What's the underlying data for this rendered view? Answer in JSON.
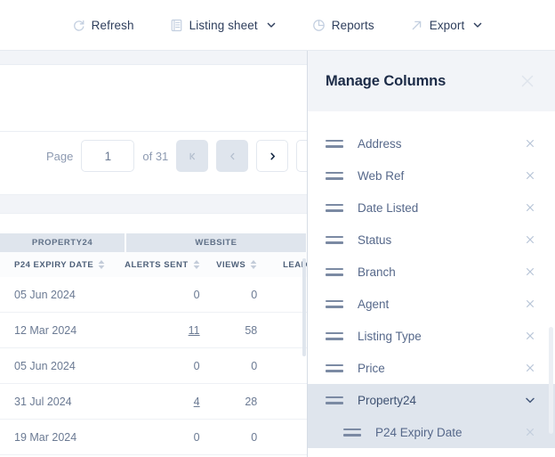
{
  "toolbar": {
    "items": [
      {
        "label": "Refresh",
        "icon": "refresh-icon",
        "caret": false
      },
      {
        "label": "Listing sheet",
        "icon": "list-sheet-icon",
        "caret": true
      },
      {
        "label": "Reports",
        "icon": "pie-chart-icon",
        "caret": false
      },
      {
        "label": "Export",
        "icon": "arrow-up-right-icon",
        "caret": true
      }
    ]
  },
  "pagination": {
    "page_label": "Page",
    "page_value": "1",
    "of_label": "of 31",
    "total_pages": 31,
    "buttons": [
      {
        "name": "first-page-button",
        "glyph": "|‹",
        "disabled": true
      },
      {
        "name": "previous-page-button",
        "glyph": "‹",
        "disabled": true
      },
      {
        "name": "next-page-button",
        "glyph": "›",
        "disabled": false
      },
      {
        "name": "last-page-button",
        "glyph": "›|",
        "disabled": false
      }
    ]
  },
  "table": {
    "group_headers": [
      {
        "label": "PROPERTY24"
      },
      {
        "label": "WEBSITE"
      }
    ],
    "columns": [
      {
        "label": "P24 EXPIRY DATE",
        "sortable": true
      },
      {
        "label": "ALERTS SENT",
        "sortable": true
      },
      {
        "label": "VIEWS",
        "sortable": true
      },
      {
        "label": "LEAD",
        "sortable": false
      }
    ],
    "rows": [
      {
        "expiry": "05 Jun 2024",
        "alerts": "0",
        "alerts_link": false,
        "views": "0",
        "leads": ""
      },
      {
        "expiry": "12 Mar 2024",
        "alerts": "11",
        "alerts_link": true,
        "views": "58",
        "leads": ""
      },
      {
        "expiry": "05 Jun 2024",
        "alerts": "0",
        "alerts_link": false,
        "views": "0",
        "leads": ""
      },
      {
        "expiry": "31 Jul 2024",
        "alerts": "4",
        "alerts_link": true,
        "views": "28",
        "leads": ""
      },
      {
        "expiry": "19 Mar 2024",
        "alerts": "0",
        "alerts_link": false,
        "views": "0",
        "leads": ""
      }
    ]
  },
  "panel": {
    "title": "Manage Columns",
    "close_icon": "close-icon",
    "columns": [
      {
        "label": "Address",
        "type": "item",
        "remove_icon": "close-icon"
      },
      {
        "label": "Web Ref",
        "type": "item",
        "remove_icon": "close-icon"
      },
      {
        "label": "Date Listed",
        "type": "item",
        "remove_icon": "close-icon"
      },
      {
        "label": "Status",
        "type": "item",
        "remove_icon": "close-icon"
      },
      {
        "label": "Branch",
        "type": "item",
        "remove_icon": "close-icon"
      },
      {
        "label": "Agent",
        "type": "item",
        "remove_icon": "close-icon"
      },
      {
        "label": "Listing Type",
        "type": "item",
        "remove_icon": "close-icon"
      },
      {
        "label": "Price",
        "type": "item",
        "remove_icon": "close-icon"
      },
      {
        "label": "Property24",
        "type": "group",
        "expanded": true,
        "chevron_icon": "chevron-down-icon"
      },
      {
        "label": "P24 Expiry Date",
        "type": "child",
        "remove_icon": "close-icon"
      }
    ]
  },
  "colors": {
    "panel_header_bg": "#f2f4f8",
    "highlight_bg": "#dfe5ed",
    "title_text": "#1c2b47",
    "body_text": "#6b7a93",
    "muted_text": "#8d9ab1"
  }
}
